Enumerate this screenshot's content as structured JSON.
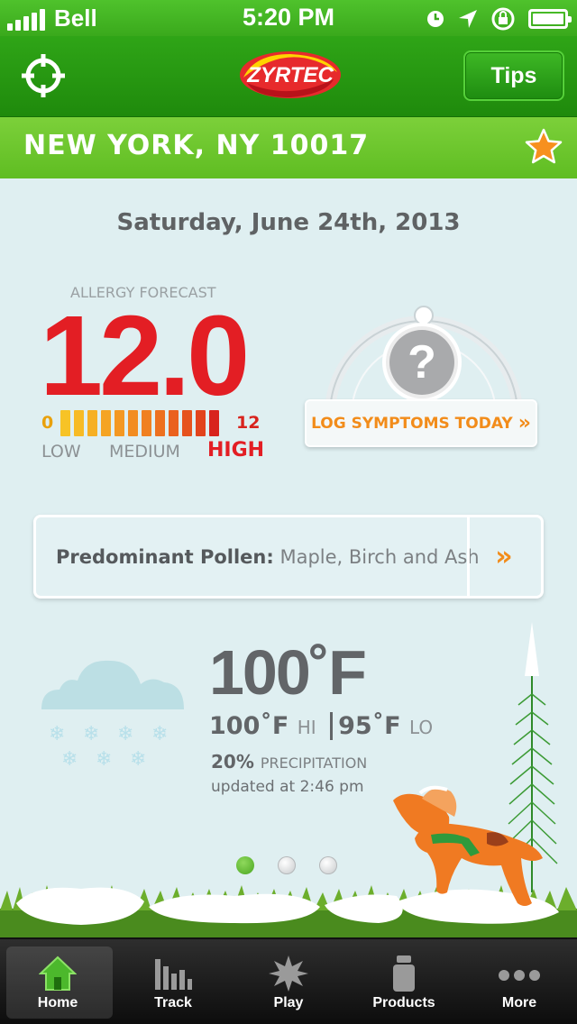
{
  "status_bar": {
    "carrier": "Bell",
    "time": "5:20 PM"
  },
  "nav": {
    "tips_label": "Tips",
    "logo_alt": "ZYRTEC"
  },
  "location": {
    "text": "NEW YORK, NY 10017"
  },
  "forecast": {
    "date": "Saturday, June 24th, 2013",
    "label": "ALLERGY FORECAST",
    "value": "12.0",
    "level": 12,
    "scale_min": "0",
    "scale_max": "12",
    "scale_low": "LOW",
    "scale_medium": "MEDIUM",
    "scale_high": "HIGH",
    "bar_colors": [
      "#f7c326",
      "#f7bb25",
      "#f6b024",
      "#f5a423",
      "#f49822",
      "#f28c21",
      "#f08020",
      "#ed701f",
      "#ea611e",
      "#e6521d",
      "#e2431c",
      "#d8231d"
    ]
  },
  "log": {
    "label": "LOG SYMPTOMS TODAY",
    "arrow": "»",
    "gauge_glyph": "?"
  },
  "pollen": {
    "label": "Predominant Pollen:",
    "value": "Maple, Birch and Ash",
    "arrow": "»"
  },
  "weather": {
    "temp": "100˚F",
    "hi": "100˚F",
    "hi_label": "HI",
    "lo": "95˚F",
    "lo_label": "LO",
    "precip": "20%",
    "precip_label": "PRECIPITATION",
    "updated": "updated at 2:46 pm"
  },
  "pager": {
    "active_index": 0,
    "count": 3
  },
  "tabs": [
    {
      "label": "Home",
      "icon": "home-icon",
      "active": true
    },
    {
      "label": "Track",
      "icon": "bar-chart-icon",
      "active": false
    },
    {
      "label": "Play",
      "icon": "burst-icon",
      "active": false
    },
    {
      "label": "Products",
      "icon": "bottle-icon",
      "active": false
    },
    {
      "label": "More",
      "icon": "more-icon",
      "active": false
    }
  ],
  "colors": {
    "green": "#2fa517",
    "red": "#e31e24",
    "orange": "#f28c1a"
  }
}
